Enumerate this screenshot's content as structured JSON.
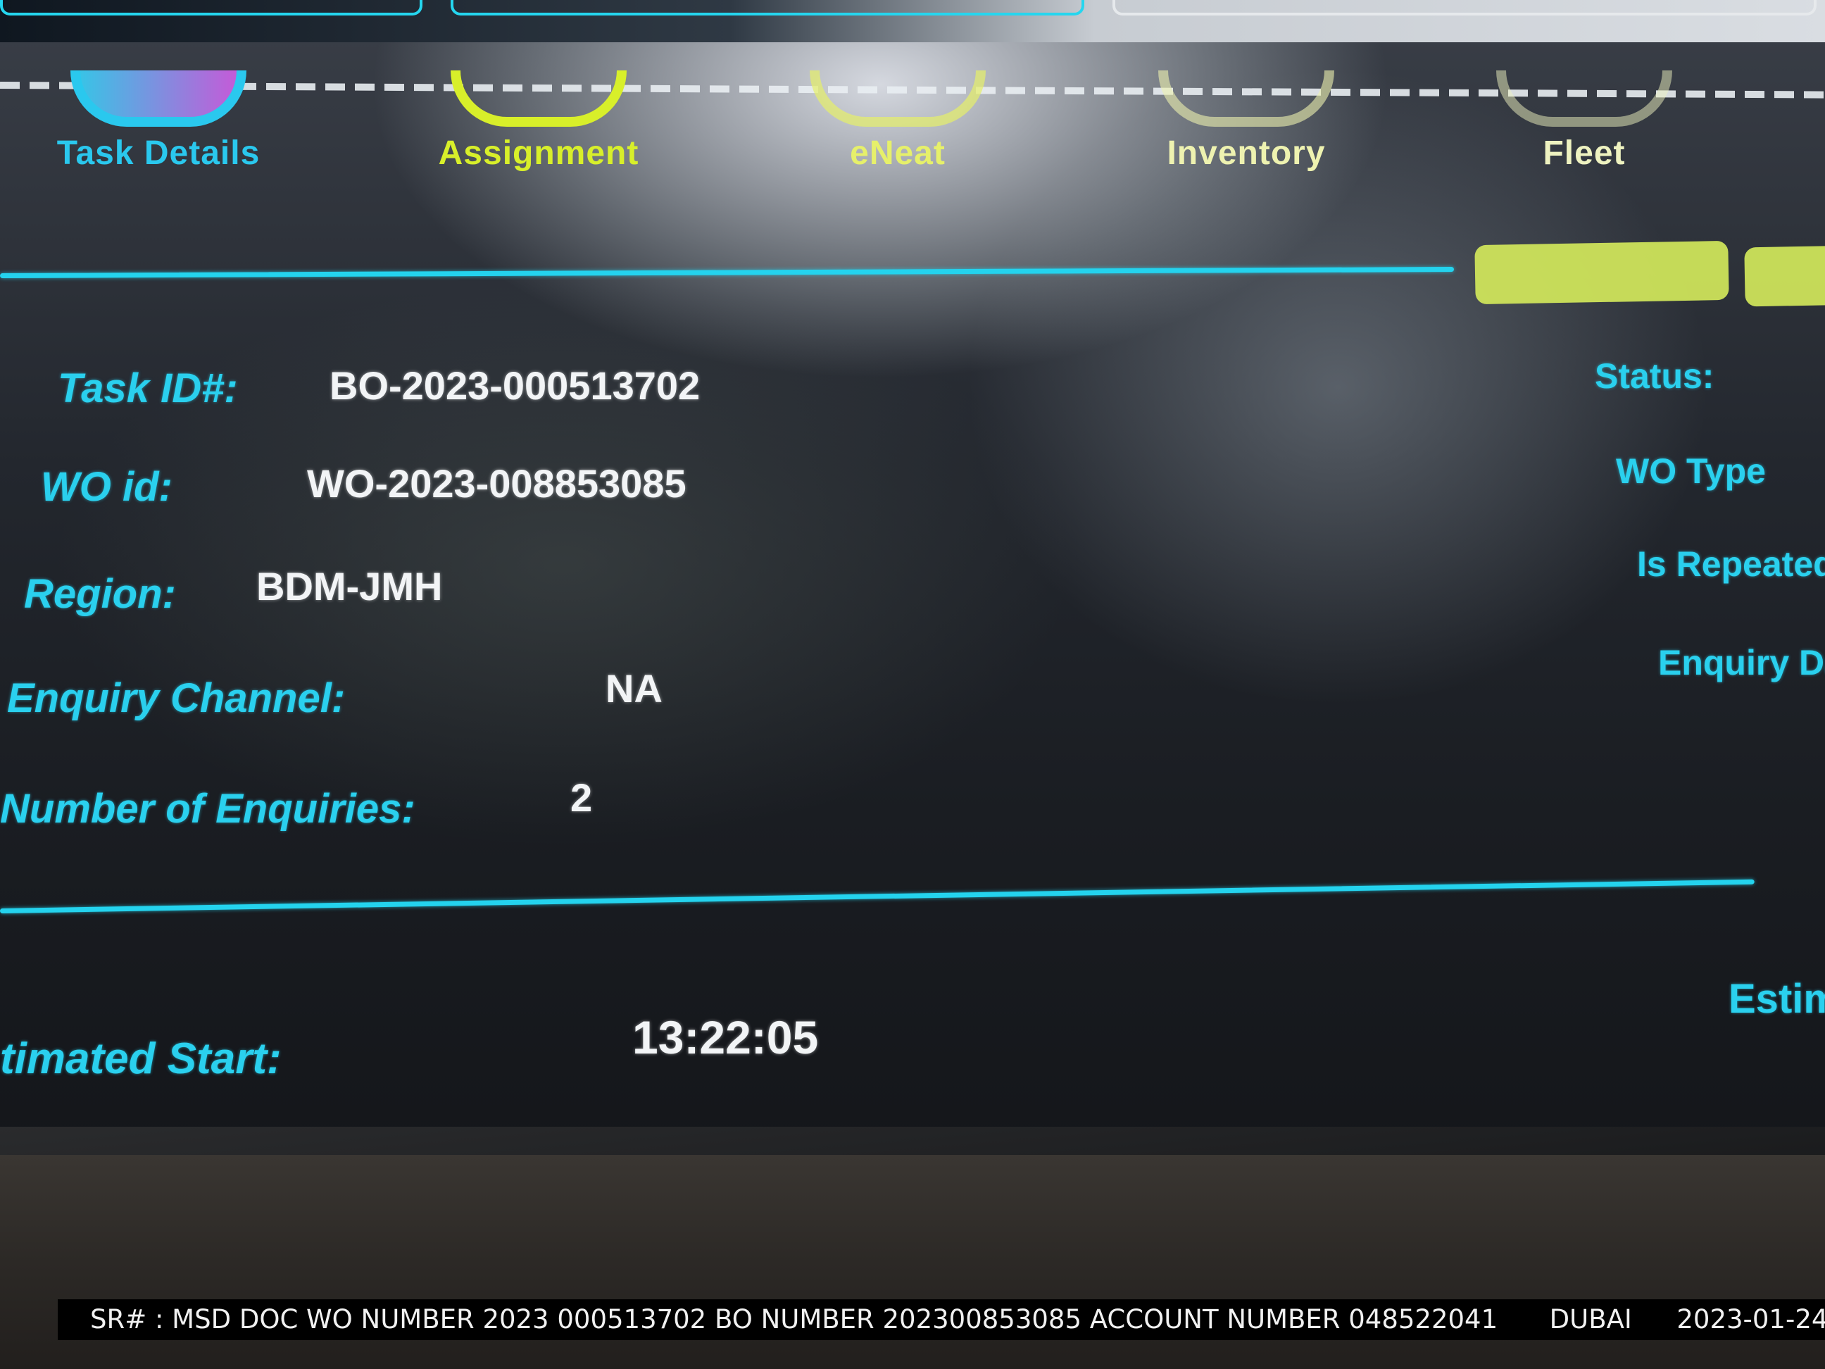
{
  "nav": {
    "steps": [
      {
        "label": "Task Details",
        "color": "#2ac8ee"
      },
      {
        "label": "Assignment",
        "color": "#d8ef2a"
      },
      {
        "label": "eNeat",
        "color": "#e6f06a"
      },
      {
        "label": "Inventory",
        "color": "#eef2b0"
      },
      {
        "label": "Fleet",
        "color": "#eef2c0"
      }
    ]
  },
  "actions": {
    "btn1": "",
    "btn2": ""
  },
  "details": {
    "task_id_label": "Task ID#:",
    "task_id_value": "BO-2023-000513702",
    "wo_id_label": "WO id:",
    "wo_id_value": "WO-2023-008853085",
    "region_label": "Region:",
    "region_value": "BDM-JMH",
    "enquiry_channel_label": "Enquiry Channel:",
    "enquiry_channel_value": "NA",
    "num_enquiries_label": "Number of Enquiries:",
    "num_enquiries_value": "2"
  },
  "right_column": {
    "status_label": "Status:",
    "wo_type_label": "WO Type",
    "is_repeated_label": "Is Repeated",
    "enquiry_date_label": "Enquiry Da"
  },
  "schedule": {
    "estimated_start_label": "timated Start:",
    "estimated_start_value": "13:22:05",
    "estimated_right_label": "Estim"
  },
  "caption": {
    "sr_text": "SR# : MSD DOC WO NUMBER 2023 000513702 BO NUMBER 202300853085 ACCOUNT NUMBER 048522041",
    "city": "DUBAI",
    "date": "2023-01-24"
  }
}
